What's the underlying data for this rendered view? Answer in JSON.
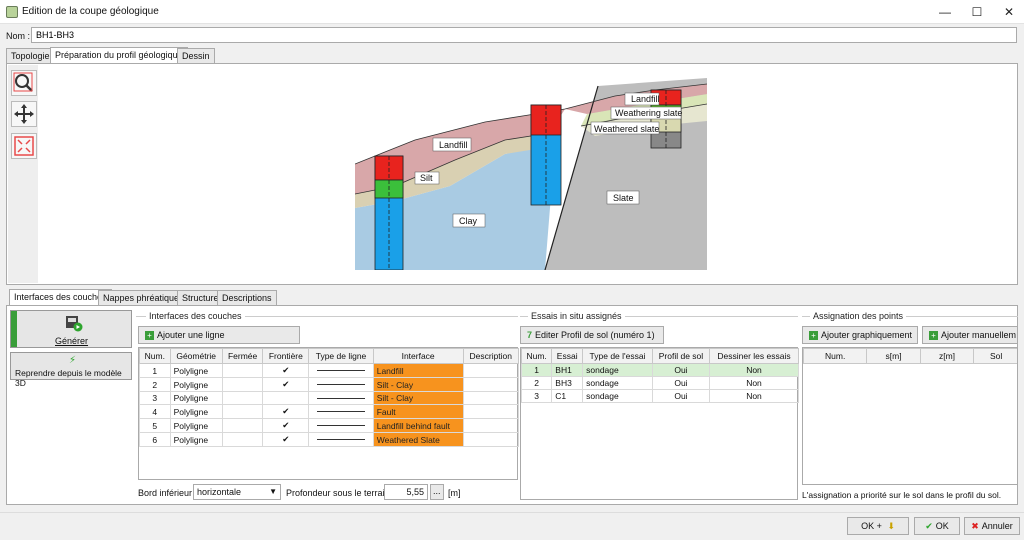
{
  "window": {
    "title": "Edition de la coupe géologique"
  },
  "name": {
    "label": "Nom :",
    "value": "BH1-BH3"
  },
  "top_tabs": [
    "Topologie",
    "Préparation du profil géologique",
    "Dessin"
  ],
  "diagram": {
    "labels": {
      "landfill": "Landfill",
      "silt": "Silt",
      "clay": "Clay",
      "slate": "Slate",
      "landfill_right": "Landfill",
      "weathering": "Weathering slate",
      "weathered": "Weathered slate"
    }
  },
  "bottom_tabs": [
    "Interfaces des couches",
    "Nappes phréatiques",
    "Structure",
    "Descriptions"
  ],
  "left_actions": {
    "generate": "Générer",
    "rebuild": "Reprendre depuis le modèle 3D"
  },
  "interfaces": {
    "title": "Interfaces des couches",
    "add_button": "Ajouter une ligne",
    "headers": [
      "Num.",
      "Géométrie",
      "Fermée",
      "Frontière",
      "Type de ligne",
      "Interface",
      "Description"
    ],
    "rows": [
      {
        "num": "1",
        "geom": "Polyligne",
        "frontiere": "✔",
        "interface": "Landfill"
      },
      {
        "num": "2",
        "geom": "Polyligne",
        "frontiere": "✔",
        "interface": "Silt - Clay"
      },
      {
        "num": "3",
        "geom": "Polyligne",
        "frontiere": "",
        "interface": "Silt - Clay"
      },
      {
        "num": "4",
        "geom": "Polyligne",
        "frontiere": "✔",
        "interface": "Fault"
      },
      {
        "num": "5",
        "geom": "Polyligne",
        "frontiere": "✔",
        "interface": "Landfill behind fault"
      },
      {
        "num": "6",
        "geom": "Polyligne",
        "frontiere": "✔",
        "interface": "Weathered Slate"
      }
    ],
    "bord_label": "Bord inférieur :",
    "bord_value": "horizontale",
    "profondeur_label": "Profondeur sous le terrain :",
    "profondeur_value": "5,55",
    "dots": "...",
    "unit": "[m]"
  },
  "essais": {
    "title": "Essais in situ assignés",
    "edit_button": "Editer Profil de sol (numéro 1)",
    "headers": [
      "Num.",
      "Essai",
      "Type de l'essai",
      "Profil de sol",
      "Dessiner les essais"
    ],
    "rows": [
      {
        "num": "1",
        "essai": "BH1",
        "type": "sondage",
        "profil": "Oui",
        "dessiner": "Non"
      },
      {
        "num": "2",
        "essai": "BH3",
        "type": "sondage",
        "profil": "Oui",
        "dessiner": "Non"
      },
      {
        "num": "3",
        "essai": "C1",
        "type": "sondage",
        "profil": "Oui",
        "dessiner": "Non"
      }
    ]
  },
  "points": {
    "title": "Assignation des points",
    "add_graph": "Ajouter graphiquement",
    "add_manual": "Ajouter manuellem",
    "headers": [
      "Num.",
      "s[m]",
      "z[m]",
      "Sol"
    ],
    "note": "L'assignation a priorité sur le sol dans le profil du sol."
  },
  "footer": {
    "ok_plus": "OK +",
    "ok": "OK",
    "cancel": "Annuler"
  }
}
